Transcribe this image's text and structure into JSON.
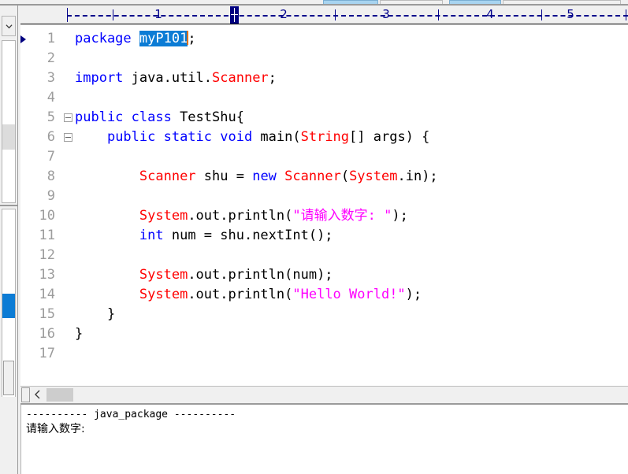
{
  "window": {
    "tabs": [
      {
        "label": "",
        "state": "active"
      },
      {
        "label": "",
        "state": "inactive"
      },
      {
        "label": "",
        "state": "inactive"
      },
      {
        "label": "",
        "state": "inactive"
      }
    ]
  },
  "left_panel": {
    "scroll_down_icon": "chevron-down-icon",
    "selected_item_color": "#0c7cd5"
  },
  "ruler": {
    "numbers": [
      "1",
      "2",
      "3",
      "4",
      "5"
    ],
    "caret_marker_label": "+",
    "color": "#00008b"
  },
  "editor": {
    "line_numbers": [
      "1",
      "2",
      "3",
      "4",
      "5",
      "6",
      "7",
      "8",
      "9",
      "10",
      "11",
      "12",
      "13",
      "14",
      "15",
      "16",
      "17"
    ],
    "current_line": "1",
    "fold_lines": [
      "5",
      "6"
    ],
    "selection_text": "myP101",
    "colors": {
      "keyword": "#0000ff",
      "type": "#ff0000",
      "string": "#ff00ff",
      "plain": "#000000",
      "selection_bg": "#0c7cd5",
      "caret": "#e07000",
      "line_number": "#9c9c9c"
    },
    "lines": [
      {
        "n": "1",
        "tokens": [
          {
            "t": "package ",
            "c": "kw"
          },
          {
            "t": "myP101",
            "c": "sel"
          },
          {
            "t": "CARET",
            "c": "caret"
          },
          {
            "t": ";",
            "c": "pln"
          }
        ]
      },
      {
        "n": "2",
        "tokens": []
      },
      {
        "n": "3",
        "tokens": [
          {
            "t": "import ",
            "c": "kw"
          },
          {
            "t": "java.util.",
            "c": "pln"
          },
          {
            "t": "Scanner",
            "c": "type"
          },
          {
            "t": ";",
            "c": "pln"
          }
        ]
      },
      {
        "n": "4",
        "tokens": []
      },
      {
        "n": "5",
        "tokens": [
          {
            "t": "public class ",
            "c": "kw"
          },
          {
            "t": "TestShu{",
            "c": "pln"
          }
        ]
      },
      {
        "n": "6",
        "tokens": [
          {
            "t": "    ",
            "c": "pln"
          },
          {
            "t": "public static void ",
            "c": "kw"
          },
          {
            "t": "main(",
            "c": "pln"
          },
          {
            "t": "String",
            "c": "type"
          },
          {
            "t": "[] args) {",
            "c": "pln"
          }
        ]
      },
      {
        "n": "7",
        "tokens": []
      },
      {
        "n": "8",
        "tokens": [
          {
            "t": "        ",
            "c": "pln"
          },
          {
            "t": "Scanner",
            "c": "type"
          },
          {
            "t": " shu = ",
            "c": "pln"
          },
          {
            "t": "new ",
            "c": "kw"
          },
          {
            "t": "Scanner",
            "c": "type"
          },
          {
            "t": "(",
            "c": "pln"
          },
          {
            "t": "System",
            "c": "type"
          },
          {
            "t": ".in);",
            "c": "pln"
          }
        ]
      },
      {
        "n": "9",
        "tokens": []
      },
      {
        "n": "10",
        "tokens": [
          {
            "t": "        ",
            "c": "pln"
          },
          {
            "t": "System",
            "c": "type"
          },
          {
            "t": ".out.println(",
            "c": "pln"
          },
          {
            "t": "\"请输入数字: \"",
            "c": "str"
          },
          {
            "t": ");",
            "c": "pln"
          }
        ]
      },
      {
        "n": "11",
        "tokens": [
          {
            "t": "        ",
            "c": "pln"
          },
          {
            "t": "int",
            "c": "kw"
          },
          {
            "t": " num = shu.nextInt();",
            "c": "pln"
          }
        ]
      },
      {
        "n": "12",
        "tokens": []
      },
      {
        "n": "13",
        "tokens": [
          {
            "t": "        ",
            "c": "pln"
          },
          {
            "t": "System",
            "c": "type"
          },
          {
            "t": ".out.println(num);",
            "c": "pln"
          }
        ]
      },
      {
        "n": "14",
        "tokens": [
          {
            "t": "        ",
            "c": "pln"
          },
          {
            "t": "System",
            "c": "type"
          },
          {
            "t": ".out.println(",
            "c": "pln"
          },
          {
            "t": "\"Hello World!\"",
            "c": "str"
          },
          {
            "t": ");",
            "c": "pln"
          }
        ]
      },
      {
        "n": "15",
        "tokens": [
          {
            "t": "    }",
            "c": "pln"
          }
        ]
      },
      {
        "n": "16",
        "tokens": [
          {
            "t": "}",
            "c": "pln"
          }
        ]
      },
      {
        "n": "17",
        "tokens": []
      }
    ]
  },
  "scrollbar": {
    "left_arrow_icon": "chevron-left-icon"
  },
  "console": {
    "line1": "---------- java_package ----------",
    "line2": "请输入数字:"
  }
}
